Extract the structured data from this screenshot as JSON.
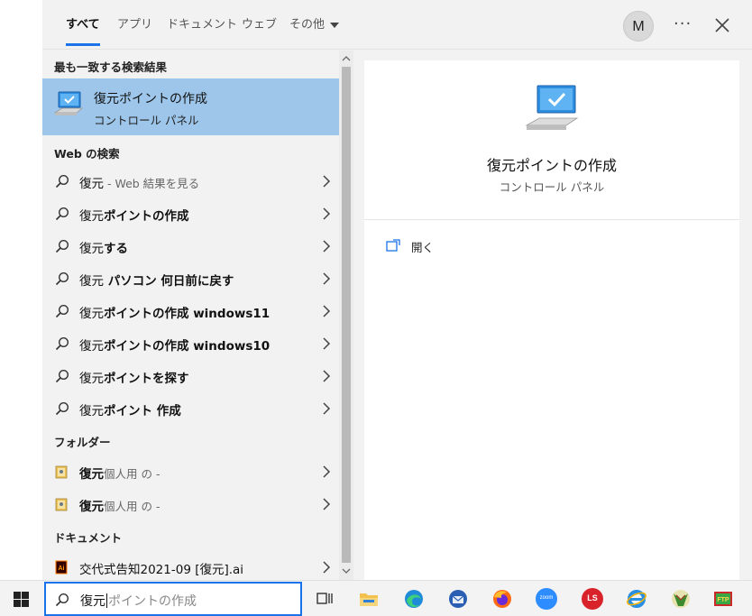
{
  "tabs": [
    {
      "label": "すべて",
      "active": true
    },
    {
      "label": "アプリ"
    },
    {
      "label": "ドキュメント"
    },
    {
      "label": "ウェブ"
    },
    {
      "label": "その他"
    }
  ],
  "header": {
    "avatar_initial": "M",
    "more_label": "···"
  },
  "best_match": {
    "section_label": "最も一致する検索結果",
    "title": "復元ポイントの作成",
    "subtitle": "コントロール パネル"
  },
  "web": {
    "section_label": "Web の検索",
    "items": [
      {
        "prefix": "復元",
        "bold": "",
        "hint": " - Web 結果を見る"
      },
      {
        "prefix": "復元",
        "bold": "ポイントの作成",
        "hint": ""
      },
      {
        "prefix": "復元",
        "bold": "する",
        "hint": ""
      },
      {
        "prefix": "復元",
        "bold": " パソコン 何日前に戻す",
        "hint": ""
      },
      {
        "prefix": "復元",
        "bold": "ポイントの作成 windows11",
        "hint": ""
      },
      {
        "prefix": "復元",
        "bold": "ポイントの作成 windows10",
        "hint": ""
      },
      {
        "prefix": "復元",
        "bold": "ポイントを探す",
        "hint": ""
      },
      {
        "prefix": "復元",
        "bold": "ポイント 作成",
        "hint": ""
      }
    ]
  },
  "folders": {
    "section_label": "フォルダー",
    "items": [
      {
        "bold": "復元",
        "rest": "個人用 の -"
      },
      {
        "bold": "復元",
        "rest": "個人用 の -"
      }
    ]
  },
  "documents": {
    "section_label": "ドキュメント",
    "items": [
      {
        "name": "交代式告知2021-09 [復元].ai"
      }
    ]
  },
  "preview": {
    "title": "復元ポイントの作成",
    "subtitle": "コントロール パネル",
    "open_label": "開く"
  },
  "search": {
    "typed": "復元",
    "suggestion": "ポイントの作成"
  },
  "taskbar": {
    "zoom_label": "zoom",
    "ls_label": "LS"
  },
  "colors": {
    "accent": "#1a73e8",
    "highlight": "#9dc6ea"
  }
}
